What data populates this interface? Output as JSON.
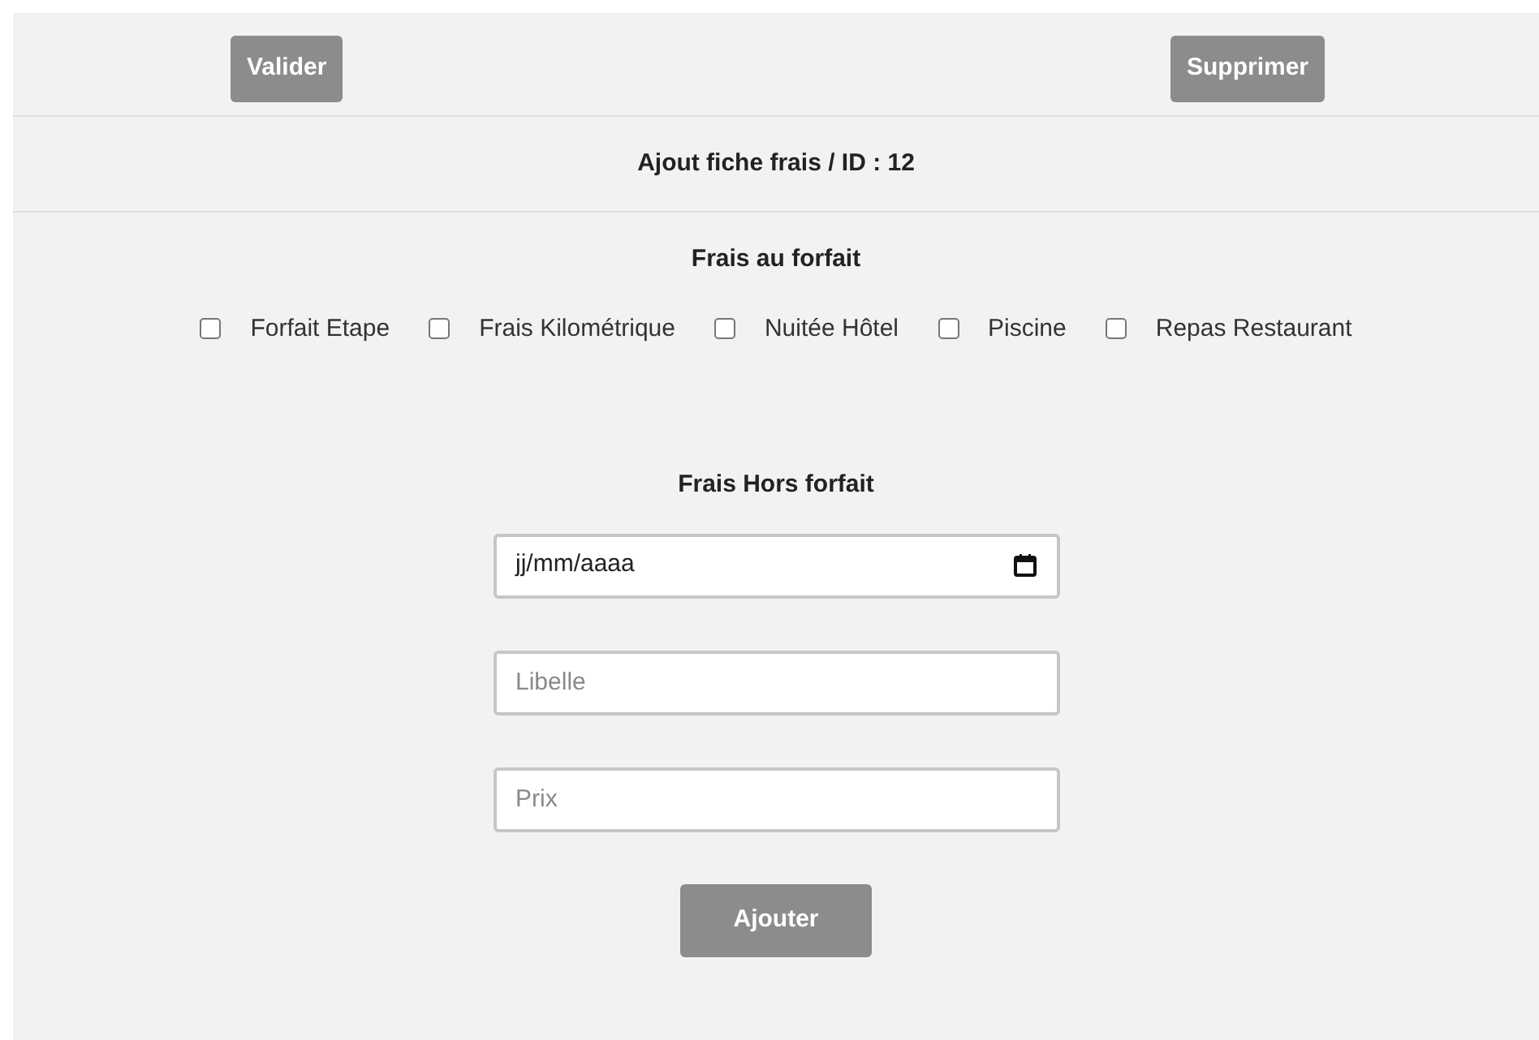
{
  "toolbar": {
    "buttons": [
      {
        "label": "Valider",
        "kind": "left"
      },
      {
        "label": "Supprimer",
        "kind": "right"
      }
    ]
  },
  "heading": "Ajout fiche frais / ID : 12",
  "forfait": {
    "title": "Frais au forfait",
    "options": [
      {
        "label": "Forfait Etape",
        "checked": false
      },
      {
        "label": "Frais Kilométrique",
        "checked": false
      },
      {
        "label": "Nuitée Hôtel",
        "checked": false
      },
      {
        "label": "Piscine",
        "checked": false
      },
      {
        "label": "Repas Restaurant",
        "checked": false
      }
    ]
  },
  "hors_forfait": {
    "title": "Frais Hors forfait",
    "date": {
      "value": "jj/mm/aaaa"
    },
    "fields": [
      {
        "placeholder": "Libelle"
      },
      {
        "placeholder": "Prix"
      }
    ],
    "button": "Ajouter"
  }
}
